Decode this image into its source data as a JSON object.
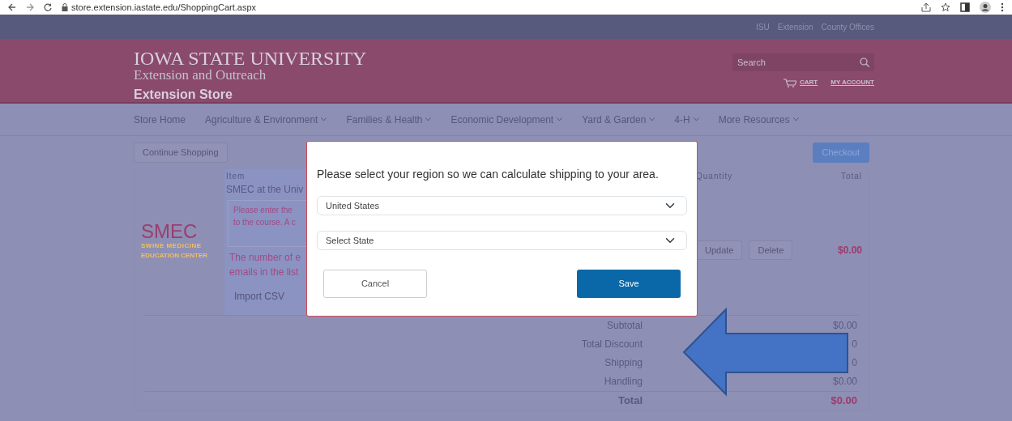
{
  "browser": {
    "url": "store.extension.iastate.edu/ShoppingCart.aspx"
  },
  "top_links": [
    "ISU",
    "Extension",
    "County Offices"
  ],
  "header": {
    "university": "IOWA STATE UNIVERSITY",
    "unit": "Extension and Outreach",
    "store": "Extension Store",
    "search": {
      "placeholder": "Search"
    },
    "links": [
      "CART",
      "MY ACCOUNT"
    ]
  },
  "nav": [
    {
      "label": "Store Home",
      "has_menu": false
    },
    {
      "label": "Agriculture & Environment",
      "has_menu": true
    },
    {
      "label": "Families & Health",
      "has_menu": true
    },
    {
      "label": "Economic Development",
      "has_menu": true
    },
    {
      "label": "Yard & Garden",
      "has_menu": true
    },
    {
      "label": "4-H",
      "has_menu": true
    },
    {
      "label": "More Resources",
      "has_menu": true
    }
  ],
  "cart": {
    "continue_button": "Continue Shopping",
    "checkout_button": "Checkout",
    "columns": {
      "item": "Item",
      "quantity": "Quantity",
      "total": "Total"
    },
    "item": {
      "logo": {
        "name": "SMEC",
        "sub1": "SWINE MEDICINE",
        "sub2": "EDUCATION CENTER"
      },
      "title": "SMEC at the Univ",
      "note": [
        "Please enter the",
        "to the course. A c"
      ],
      "warning": [
        "The number of e",
        "emails in the list"
      ],
      "import_button": "Import CSV",
      "update_button": "Update",
      "delete_button": "Delete",
      "total": "$0.00"
    },
    "summary": [
      {
        "label": "Subtotal",
        "value": "$0.00",
        "kind": "normal"
      },
      {
        "label": "Total Discount",
        "value": "0",
        "kind": "normal"
      },
      {
        "label": "Shipping",
        "value": "0",
        "kind": "normal"
      },
      {
        "label": "Handling",
        "value": "$0.00",
        "kind": "normal"
      },
      {
        "label": "Total",
        "value": "$0.00",
        "kind": "total"
      }
    ]
  },
  "modal": {
    "message": "Please select your region so we can calculate shipping to your area.",
    "country": "United States",
    "state": "Select State",
    "cancel": "Cancel",
    "save": "Save"
  }
}
